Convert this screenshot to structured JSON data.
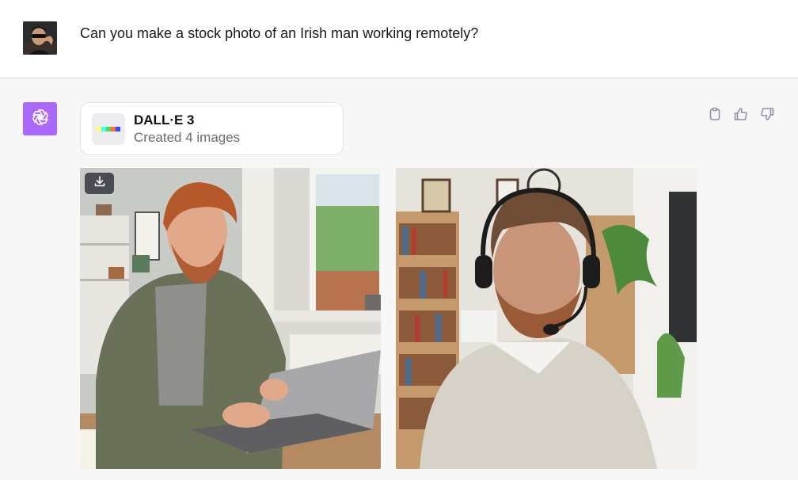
{
  "user": {
    "message": "Can you make a stock photo of an Irish man working remotely?",
    "avatar_icon": "user-avatar-photo"
  },
  "assistant": {
    "avatar_icon": "openai-logo-icon",
    "accent": "#ab68ff",
    "tool": {
      "title": "DALL·E 3",
      "subtitle": "Created 4 images",
      "icon": "dalle-color-bar-icon"
    },
    "actions": [
      {
        "icon": "clipboard-icon"
      },
      {
        "icon": "thumbs-up-icon"
      },
      {
        "icon": "thumbs-down-icon"
      }
    ],
    "images": [
      {
        "kind": "redhead-man-laptop-desk",
        "download_icon": "download-icon"
      },
      {
        "kind": "bearded-man-headset-bookshelf"
      }
    ]
  }
}
